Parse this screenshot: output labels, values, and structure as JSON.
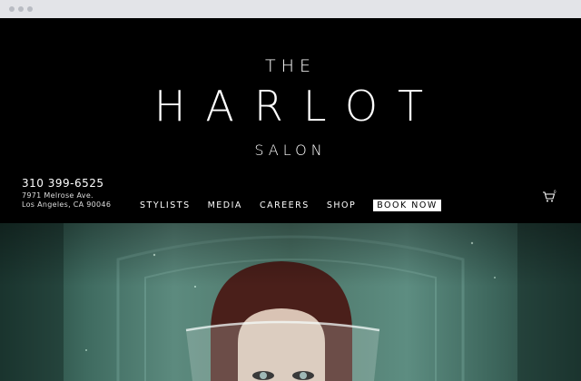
{
  "brand": {
    "the": "THE",
    "name": "HARLOT",
    "salon": "SALON"
  },
  "contact": {
    "phone": "310 399-6525",
    "address_line1": "7971 Melrose Ave.",
    "address_line2": "Los Angeles, CA 90046"
  },
  "nav": {
    "items": [
      "STYLISTS",
      "MEDIA",
      "CAREERS",
      "SHOP"
    ],
    "book": "BOOK NOW"
  },
  "cart": {
    "icon": "cart-icon",
    "count": "0"
  },
  "colors": {
    "header_bg": "#000000",
    "text": "#ffffff",
    "hero_teal": "#4d7669"
  }
}
